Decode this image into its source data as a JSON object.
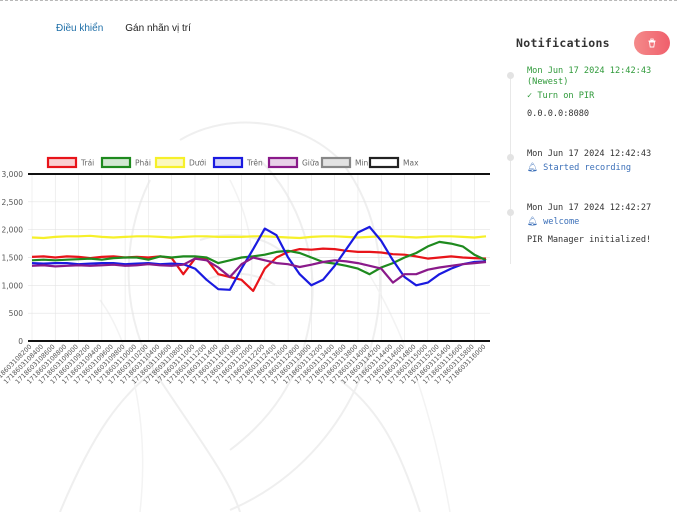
{
  "nav": {
    "tab_control": "Điều khiển",
    "tab_label_location": "Gán nhãn vị trí"
  },
  "notifications": {
    "title": "Notifications",
    "clear_icon": "trash-icon",
    "items": [
      {
        "time": "Mon Jun 17 2024 12:42:43",
        "suffix": "(Newest)",
        "icon": "check-icon",
        "message": "Turn on PIR",
        "detail": "0.0.0.0:8080"
      },
      {
        "time": "Mon Jun 17 2024 12:42:43",
        "icon": "bell-icon",
        "message": "Started recording",
        "detail": ""
      },
      {
        "time": "Mon Jun 17 2024 12:42:27",
        "icon": "bell-icon",
        "message": "welcome",
        "detail": "PIR Manager initialized!"
      }
    ]
  },
  "colors": {
    "accent": "#1f6fa8",
    "newest": "#2f9a3a",
    "info": "#3b6fb8",
    "series": [
      "#e8141a",
      "#1e8a1e",
      "#f6f02a",
      "#1a1ae0",
      "#8a1a8a",
      "#888888",
      "#222222"
    ]
  },
  "chart_data": {
    "type": "line",
    "ylim": [
      0,
      3000
    ],
    "yticks": [
      "0",
      "500",
      "1,000",
      "1,500",
      "2,000",
      "2,500",
      "3,000"
    ],
    "yvalues": [
      0,
      500,
      1000,
      1500,
      2000,
      2500,
      3000
    ],
    "x": [
      "1718603108200",
      "1718603108400",
      "1718603108600",
      "1718603108800",
      "1718603109000",
      "1718603109200",
      "1718603109400",
      "1718603109600",
      "1718603109800",
      "1718603110000",
      "1718603110200",
      "1718603110400",
      "1718603110600",
      "1718603110800",
      "1718603111000",
      "1718603111200",
      "1718603111400",
      "1718603111600",
      "1718603111800",
      "1718603112000",
      "1718603112200",
      "1718603112400",
      "1718603112600",
      "1718603112800",
      "1718603113000",
      "1718603113200",
      "1718603113400",
      "1718603113600",
      "1718603113800",
      "1718603114000",
      "1718603114200",
      "1718603114400",
      "1718603114600",
      "1718603114800",
      "1718603115000",
      "1718603115200",
      "1718603115400",
      "1718603115600",
      "1718603115800",
      "1718603116000"
    ],
    "series": [
      {
        "name": "Trái",
        "values": [
          1510,
          1520,
          1500,
          1520,
          1510,
          1490,
          1510,
          1520,
          1500,
          1510,
          1500,
          1520,
          1490,
          1200,
          1480,
          1470,
          1200,
          1150,
          1100,
          900,
          1300,
          1500,
          1600,
          1650,
          1640,
          1660,
          1650,
          1620,
          1600,
          1600,
          1590,
          1560,
          1550,
          1520,
          1480,
          1500,
          1520,
          1500,
          1490,
          1480
        ]
      },
      {
        "name": "Phải",
        "values": [
          1450,
          1460,
          1450,
          1460,
          1470,
          1480,
          1460,
          1490,
          1500,
          1500,
          1460,
          1520,
          1500,
          1520,
          1520,
          1500,
          1400,
          1450,
          1500,
          1520,
          1550,
          1600,
          1620,
          1580,
          1500,
          1420,
          1390,
          1350,
          1300,
          1200,
          1320,
          1400,
          1500,
          1580,
          1700,
          1780,
          1750,
          1700,
          1550,
          1450
        ]
      },
      {
        "name": "Dưới",
        "values": [
          1860,
          1850,
          1870,
          1880,
          1880,
          1890,
          1870,
          1860,
          1870,
          1880,
          1880,
          1870,
          1860,
          1870,
          1880,
          1880,
          1870,
          1870,
          1870,
          1880,
          1880,
          1870,
          1860,
          1850,
          1870,
          1880,
          1880,
          1870,
          1860,
          1870,
          1880,
          1880,
          1870,
          1860,
          1870,
          1880,
          1880,
          1870,
          1860,
          1880
        ]
      },
      {
        "name": "Trên",
        "values": [
          1400,
          1390,
          1400,
          1400,
          1380,
          1390,
          1400,
          1400,
          1380,
          1390,
          1400,
          1380,
          1390,
          1380,
          1300,
          1100,
          930,
          920,
          1300,
          1650,
          2020,
          1900,
          1500,
          1200,
          1000,
          1100,
          1350,
          1650,
          1950,
          2050,
          1800,
          1450,
          1150,
          1000,
          1050,
          1200,
          1300,
          1380,
          1420,
          1430
        ]
      },
      {
        "name": "Giữa",
        "values": [
          1350,
          1360,
          1340,
          1350,
          1360,
          1350,
          1360,
          1370,
          1350,
          1360,
          1380,
          1360,
          1350,
          1370,
          1480,
          1450,
          1320,
          1150,
          1380,
          1500,
          1450,
          1400,
          1380,
          1330,
          1370,
          1420,
          1450,
          1430,
          1400,
          1350,
          1300,
          1050,
          1200,
          1200,
          1280,
          1320,
          1350,
          1380,
          1400,
          1420
        ]
      },
      {
        "name": "Min",
        "values": []
      },
      {
        "name": "Max",
        "values": []
      }
    ]
  }
}
